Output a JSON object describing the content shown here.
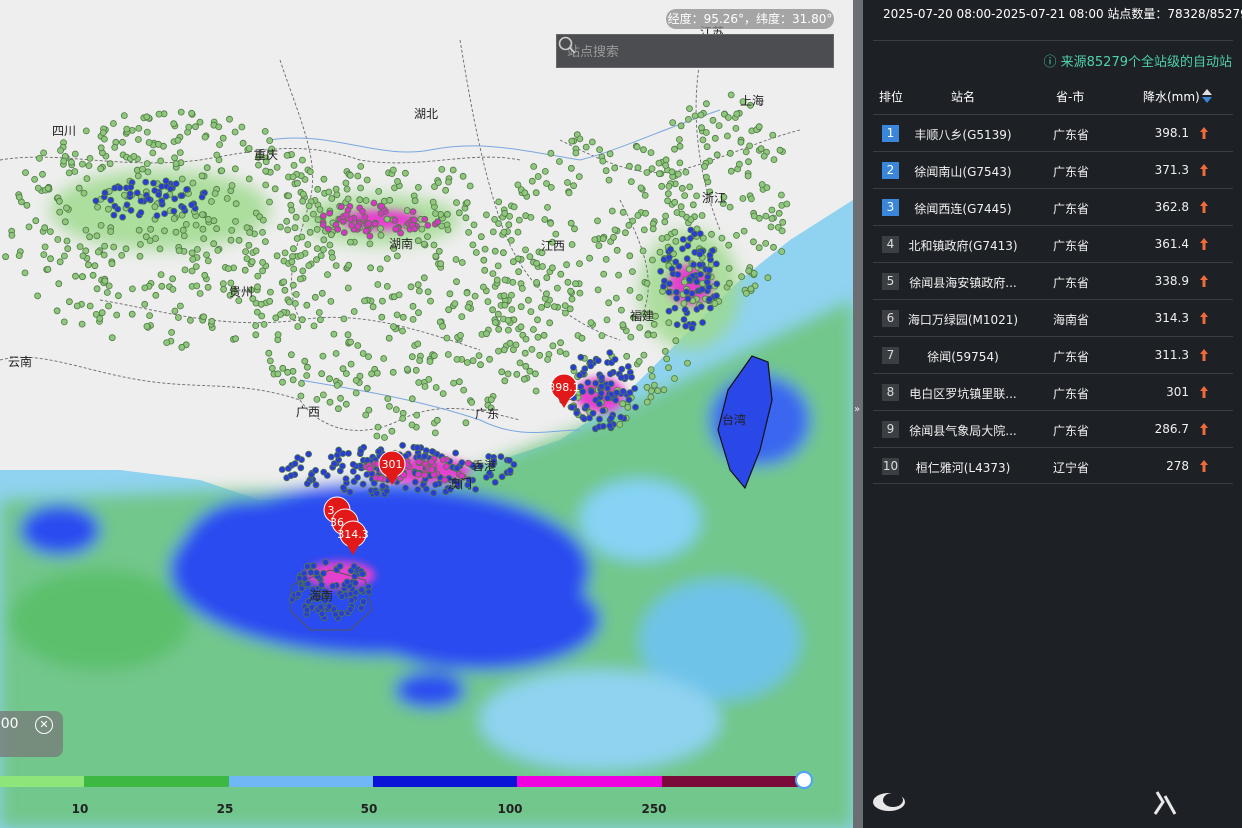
{
  "map": {
    "coord_readout": "经度：95.26°，纬度：31.80°",
    "search_placeholder": "站点搜索",
    "time_label": ":00",
    "regions": [
      {
        "name": "四川"
      },
      {
        "name": "重庆"
      },
      {
        "name": "湖北"
      },
      {
        "name": "上海"
      },
      {
        "name": "江苏"
      },
      {
        "name": "浙江"
      },
      {
        "name": "湖南"
      },
      {
        "name": "江西"
      },
      {
        "name": "贵州"
      },
      {
        "name": "福建"
      },
      {
        "name": "云南"
      },
      {
        "name": "广西"
      },
      {
        "name": "广东"
      },
      {
        "name": "台湾"
      },
      {
        "name": "香港"
      },
      {
        "name": "澳门"
      },
      {
        "name": "海南"
      }
    ],
    "pins": [
      {
        "label": "398.1"
      },
      {
        "label": "301"
      },
      {
        "label": "3"
      },
      {
        "label": "36"
      },
      {
        "label": "314.3"
      }
    ],
    "legend": {
      "ticks": [
        "10",
        "25",
        "50",
        "100",
        "250"
      ],
      "colors": [
        "#8ee67a",
        "#3db843",
        "#6fb8f5",
        "#0a14d6",
        "#f000e0",
        "#7a0a3a"
      ]
    }
  },
  "panel": {
    "header": "2025-07-20 08:00-2025-07-21 08:00  站点数量：78328/85279",
    "source_note": "来源85279个全站级的自动站",
    "columns": {
      "rank": "排位",
      "name": "站名",
      "province": "省-市",
      "precip": "降水(mm)"
    },
    "rows": [
      {
        "rank": "1",
        "name": "丰顺八乡(G5139)",
        "province": "广东省",
        "value": "398.1"
      },
      {
        "rank": "2",
        "name": "徐闻南山(G7543)",
        "province": "广东省",
        "value": "371.3"
      },
      {
        "rank": "3",
        "name": "徐闻西连(G7445)",
        "province": "广东省",
        "value": "362.8"
      },
      {
        "rank": "4",
        "name": "北和镇政府(G7413)",
        "province": "广东省",
        "value": "361.4"
      },
      {
        "rank": "5",
        "name": "徐闻县海安镇政府...",
        "province": "广东省",
        "value": "338.9"
      },
      {
        "rank": "6",
        "name": "海口万绿园(M1021)",
        "province": "海南省",
        "value": "314.3"
      },
      {
        "rank": "7",
        "name": "徐闻(59754)",
        "province": "广东省",
        "value": "311.3"
      },
      {
        "rank": "8",
        "name": "电白区罗坑镇里联...",
        "province": "广东省",
        "value": "301"
      },
      {
        "rank": "9",
        "name": "徐闻县气象局大院...",
        "province": "广东省",
        "value": "286.7"
      },
      {
        "rank": "10",
        "name": "桓仁雅河(L4373)",
        "province": "辽宁省",
        "value": "278"
      }
    ],
    "accent": "#3a86d8",
    "trend_color": "#f06a3a"
  }
}
